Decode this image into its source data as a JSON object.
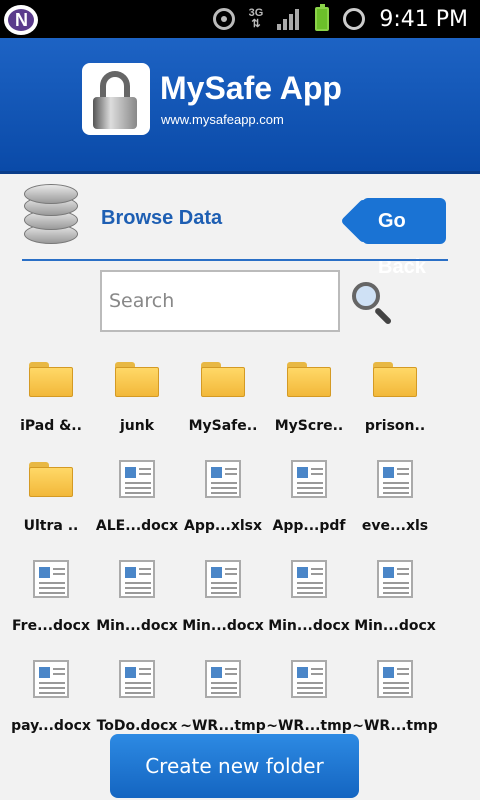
{
  "status_bar": {
    "time": "9:41 PM",
    "notification_letter": "N",
    "network_label": "3G"
  },
  "header": {
    "app_name": "MySafe App",
    "url": "www.mysafeapp.com"
  },
  "browse": {
    "title": "Browse Data",
    "go_back_label": "Go Back"
  },
  "search": {
    "placeholder": "Search"
  },
  "files": [
    {
      "name": "iPad &..",
      "type": "folder"
    },
    {
      "name": "junk",
      "type": "folder"
    },
    {
      "name": "MySafe..",
      "type": "folder"
    },
    {
      "name": "MyScre..",
      "type": "folder"
    },
    {
      "name": "prison..",
      "type": "folder"
    },
    {
      "name": "Ultra ..",
      "type": "folder"
    },
    {
      "name": "ALE...docx",
      "type": "file"
    },
    {
      "name": "App...xlsx",
      "type": "file"
    },
    {
      "name": "App...pdf",
      "type": "file"
    },
    {
      "name": "eve...xls",
      "type": "file"
    },
    {
      "name": "Fre...docx",
      "type": "file"
    },
    {
      "name": "Min...docx",
      "type": "file"
    },
    {
      "name": "Min...docx",
      "type": "file"
    },
    {
      "name": "Min...docx",
      "type": "file"
    },
    {
      "name": "Min...docx",
      "type": "file"
    },
    {
      "name": "pay...docx",
      "type": "file"
    },
    {
      "name": "ToDo.docx",
      "type": "file"
    },
    {
      "name": "~WR...tmp",
      "type": "file"
    },
    {
      "name": "~WR...tmp",
      "type": "file"
    },
    {
      "name": "~WR...tmp",
      "type": "file"
    }
  ],
  "footer": {
    "create_folder_label": "Create new folder"
  },
  "colors": {
    "header_blue": "#1d63c4",
    "accent_blue": "#1a73d4",
    "title_blue": "#1e5fb3"
  }
}
